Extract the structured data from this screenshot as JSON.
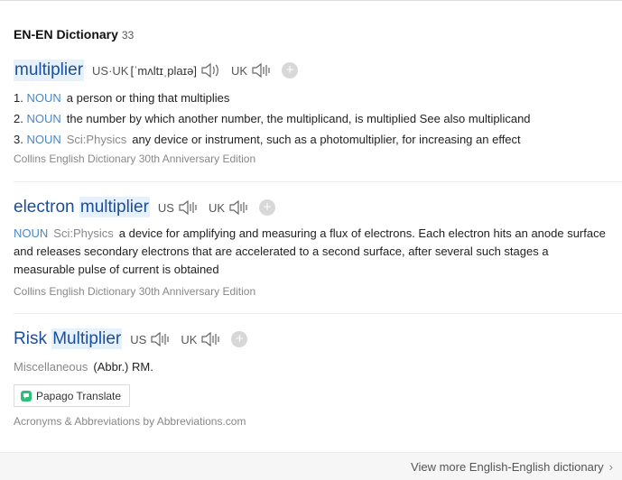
{
  "header": {
    "title": "EN-EN Dictionary",
    "count": "33"
  },
  "entries": {
    "e0": {
      "word_part1": "multiplier",
      "us_uk_label": "US·UK",
      "ipa": "[ˈmʌltɪˌplaɪə]",
      "uk_label": "UK",
      "plus": "+",
      "defs": {
        "d0": {
          "num": "1.",
          "pos": "NOUN",
          "text": "a person or thing that multiplies"
        },
        "d1": {
          "num": "2.",
          "pos": "NOUN",
          "text": "the number by which another number, the multiplicand, is multiplied See also multiplicand"
        },
        "d2": {
          "num": "3.",
          "pos": "NOUN",
          "field": "Sci:Physics",
          "text": "any device or instrument, such as a photomultiplier, for increasing an effect"
        }
      },
      "source": "Collins English Dictionary 30th Anniversary Edition"
    },
    "e1": {
      "word_part1": "electron",
      "word_part2": "multiplier",
      "us_label": "US",
      "uk_label": "UK",
      "plus": "+",
      "pos": "NOUN",
      "field": "Sci:Physics",
      "text": "a device for amplifying and measuring a flux of electrons. Each electron hits an anode surface and releases secondary electrons that are accelerated to a second surface, after several such stages a measurable pulse of current is obtained",
      "source": "Collins English Dictionary 30th Anniversary Edition"
    },
    "e2": {
      "word_part1": "Risk",
      "word_part2": "Multiplier",
      "us_label": "US",
      "uk_label": "UK",
      "plus": "+",
      "category": "Miscellaneous",
      "text": "(Abbr.) RM.",
      "papago_label": "Papago Translate",
      "source": "Acronyms & Abbreviations by Abbreviations.com"
    }
  },
  "footer": {
    "link": "View more English-English dictionary",
    "chevron": "›"
  },
  "icons": {
    "speaker": "speaker-icon",
    "add": "add-icon",
    "papago": "papago-icon",
    "chevron": "chevron-right-icon"
  },
  "colors": {
    "word_blue": "#1a4f9c",
    "pos_blue": "#4a86c7",
    "highlight": "#e6f1fb",
    "muted": "#888888"
  }
}
